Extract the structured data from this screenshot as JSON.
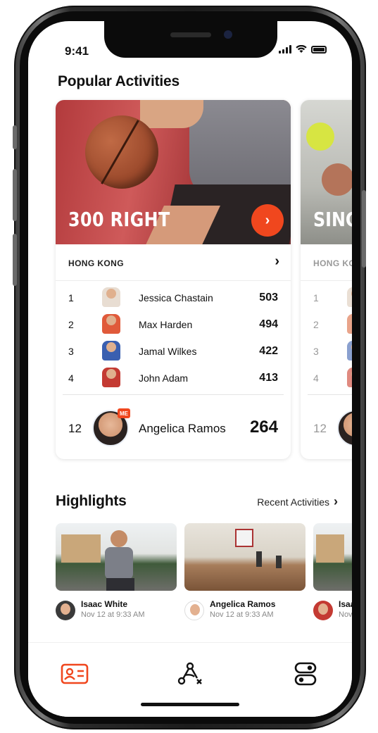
{
  "status_bar": {
    "time": "9:41"
  },
  "sections": {
    "popular_title": "Popular Activities",
    "highlights_title": "Highlights",
    "recent_link": "Recent Activities"
  },
  "activities": [
    {
      "title": "300 RIGHT",
      "region": "HONG KONG",
      "leaders": [
        {
          "rank": "1",
          "name": "Jessica Chastain",
          "score": "503"
        },
        {
          "rank": "2",
          "name": "Max Harden",
          "score": "494"
        },
        {
          "rank": "3",
          "name": "Jamal Wilkes",
          "score": "422"
        },
        {
          "rank": "4",
          "name": "John Adam",
          "score": "413"
        }
      ],
      "me": {
        "rank": "12",
        "name": "Angelica Ramos",
        "score": "264",
        "badge": "ME"
      }
    },
    {
      "title": "SINGI",
      "region": "HONG KO",
      "leaders": [
        {
          "rank": "1"
        },
        {
          "rank": "2"
        },
        {
          "rank": "3"
        },
        {
          "rank": "4"
        }
      ],
      "me": {
        "rank": "12"
      }
    }
  ],
  "highlights": [
    {
      "name": "Isaac White",
      "time": "Nov 12 at 9:33 AM"
    },
    {
      "name": "Angelica Ramos",
      "time": "Nov 12 at 9:33 AM"
    },
    {
      "name": "Isaa",
      "time": "Nov"
    }
  ],
  "tabbar": {
    "items": [
      "profile-card-icon",
      "drills-icon",
      "toggles-icon"
    ]
  },
  "colors": {
    "accent": "#f0471e",
    "text": "#111111"
  }
}
